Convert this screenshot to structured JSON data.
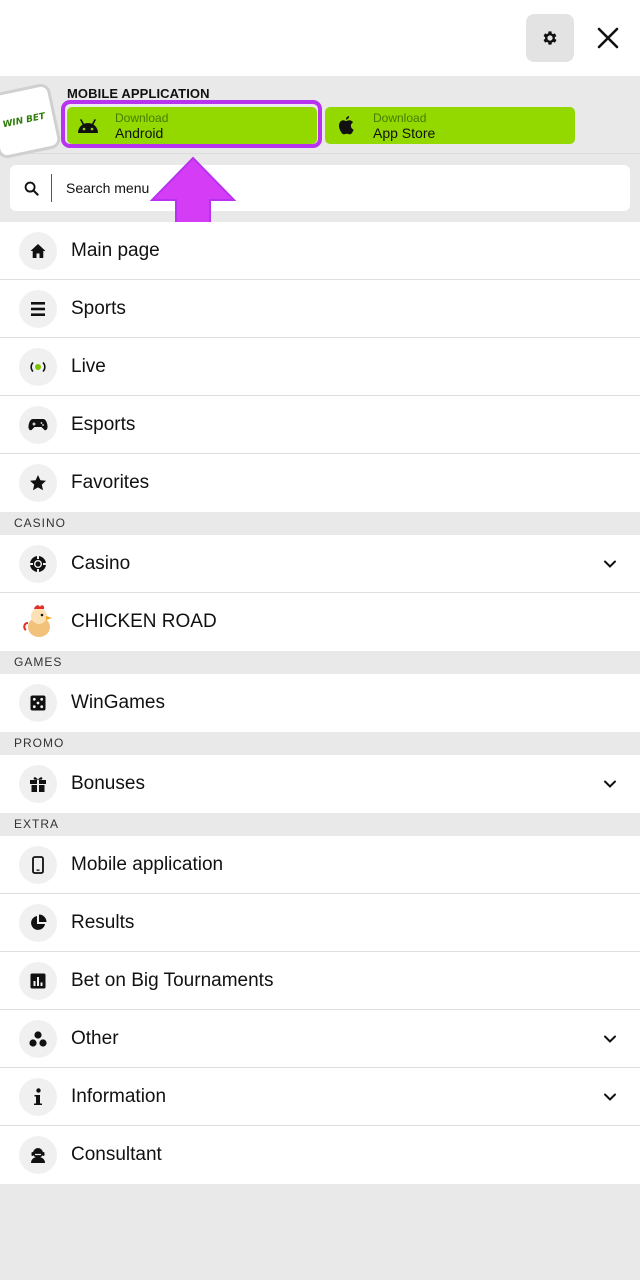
{
  "banner": {
    "title": "MOBILE APPLICATION",
    "android": {
      "sub": "Download",
      "main": "Android"
    },
    "ios": {
      "sub": "Download",
      "main": "App Store"
    },
    "logo_text": "WIN BET"
  },
  "search": {
    "placeholder": "Search menu"
  },
  "colors": {
    "accent": "#93d900",
    "highlight": "#b833f0",
    "background": "#e9e9e9"
  },
  "menu": {
    "main_items": [
      {
        "label": "Main page",
        "icon": "home-icon"
      },
      {
        "label": "Sports",
        "icon": "list-icon"
      },
      {
        "label": "Live",
        "icon": "live-broadcast-icon"
      },
      {
        "label": "Esports",
        "icon": "gamepad-icon"
      },
      {
        "label": "Favorites",
        "icon": "star-icon"
      }
    ],
    "casino_section": "CASINO",
    "casino_items": [
      {
        "label": "Casino",
        "icon": "casino-chip-icon",
        "expandable": true
      },
      {
        "label": "CHICKEN ROAD",
        "icon": "chicken-icon"
      }
    ],
    "games_section": "GAMES",
    "games_items": [
      {
        "label": "WinGames",
        "icon": "dice-icon"
      }
    ],
    "promo_section": "PROMO",
    "promo_items": [
      {
        "label": "Bonuses",
        "icon": "gift-icon",
        "expandable": true
      }
    ],
    "extra_section": "EXTRA",
    "extra_items": [
      {
        "label": "Mobile application",
        "icon": "smartphone-icon"
      },
      {
        "label": "Results",
        "icon": "pie-chart-icon"
      },
      {
        "label": "Bet on Big Tournaments",
        "icon": "bar-chart-icon"
      },
      {
        "label": "Other",
        "icon": "dots-cluster-icon",
        "expandable": true
      },
      {
        "label": "Information",
        "icon": "info-icon",
        "expandable": true
      },
      {
        "label": "Consultant",
        "icon": "support-agent-icon"
      }
    ]
  }
}
